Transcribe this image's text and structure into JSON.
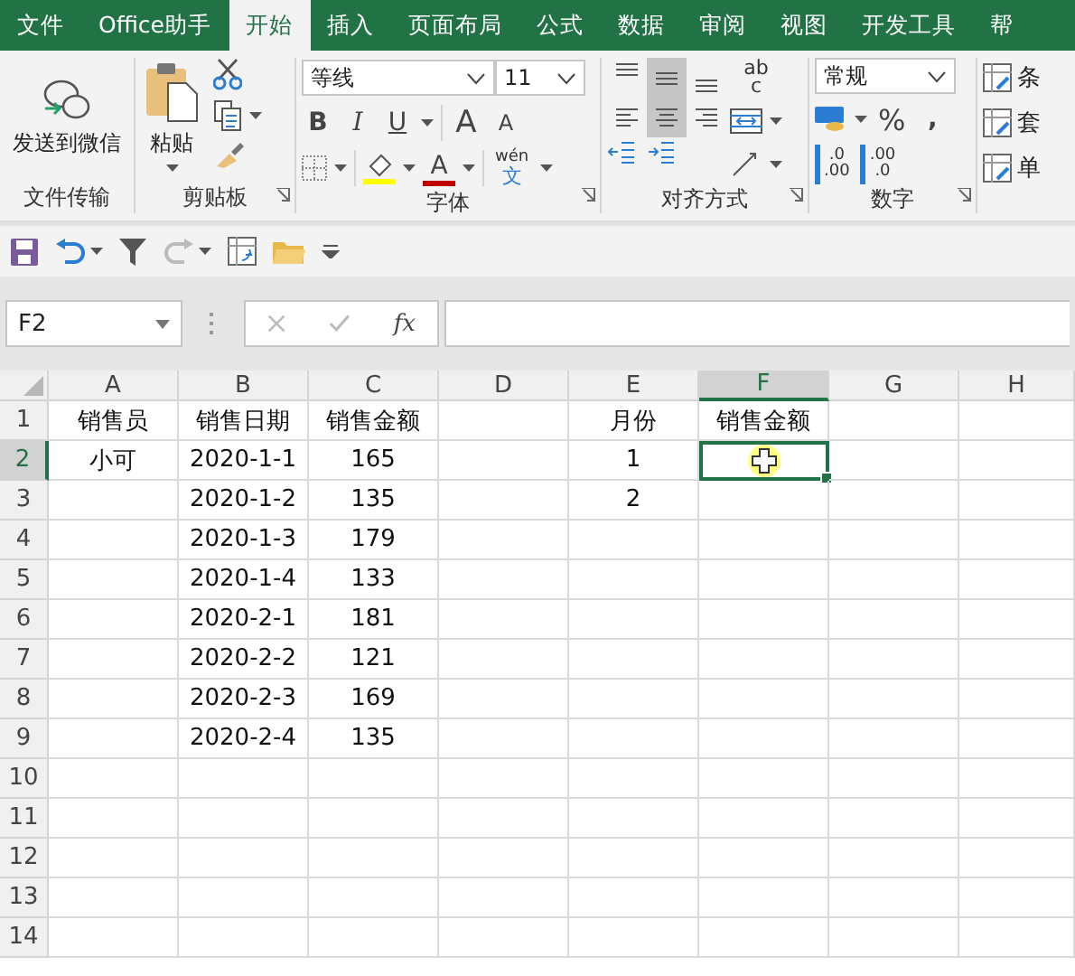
{
  "menu_tabs": [
    {
      "label": "文件",
      "selected": false
    },
    {
      "label": "Office助手",
      "selected": false
    },
    {
      "label": "开始",
      "selected": true
    },
    {
      "label": "插入",
      "selected": false
    },
    {
      "label": "页面布局",
      "selected": false
    },
    {
      "label": "公式",
      "selected": false
    },
    {
      "label": "数据",
      "selected": false
    },
    {
      "label": "审阅",
      "selected": false
    },
    {
      "label": "视图",
      "selected": false
    },
    {
      "label": "开发工具",
      "selected": false
    },
    {
      "label": "帮",
      "selected": false
    }
  ],
  "ribbon": {
    "share": {
      "button": "发送到微信",
      "label": "文件传输"
    },
    "clipboard": {
      "paste": "粘贴",
      "label": "剪贴板"
    },
    "font": {
      "font_name": "等线",
      "font_size": "11",
      "style_buttons": [
        "B",
        "I",
        "U"
      ],
      "grow": "A",
      "shrink": "A",
      "color_letter": "A",
      "phonetic_top": "wén",
      "phonetic_bottom": "文",
      "label": "字体"
    },
    "alignment": {
      "buttons": [
        {
          "kind": "top",
          "selected": false
        },
        {
          "kind": "middle",
          "selected": true
        },
        {
          "kind": "bottom",
          "selected": false
        },
        {
          "kind": "left",
          "selected": false
        },
        {
          "kind": "center",
          "selected": true
        },
        {
          "kind": "right",
          "selected": false
        }
      ],
      "wrap_top": "ab",
      "wrap_bottom": "c",
      "label": "对齐方式"
    },
    "number": {
      "format": "常规",
      "percent": "%",
      "comma": ",",
      "decimals": [
        {
          "top": ".0",
          "bottom": ".00"
        },
        {
          "top": ".00",
          "bottom": ".0"
        }
      ],
      "label": "数字"
    },
    "styles": {
      "items": [
        "条",
        "套",
        "单"
      ]
    }
  },
  "name_box": "F2",
  "fx": "fx",
  "columns": [
    {
      "label": "A",
      "selected": false
    },
    {
      "label": "B",
      "selected": false
    },
    {
      "label": "C",
      "selected": false
    },
    {
      "label": "D",
      "selected": false
    },
    {
      "label": "E",
      "selected": false
    },
    {
      "label": "F",
      "selected": true
    },
    {
      "label": "G",
      "selected": false
    },
    {
      "label": "H",
      "selected": false
    }
  ],
  "rows": [
    {
      "number": "1",
      "selected": false,
      "cells": [
        "销售员",
        "销售日期",
        "销售金额",
        null,
        "月份",
        "销售金额"
      ]
    },
    {
      "number": "2",
      "selected": true,
      "cells": [
        "小可",
        "2020-1-1",
        "165",
        null,
        "1"
      ]
    },
    {
      "number": "3",
      "selected": false,
      "cells": [
        null,
        "2020-1-2",
        "135",
        null,
        "2"
      ]
    },
    {
      "number": "4",
      "selected": false,
      "cells": [
        null,
        "2020-1-3",
        "179"
      ]
    },
    {
      "number": "5",
      "selected": false,
      "cells": [
        null,
        "2020-1-4",
        "133"
      ]
    },
    {
      "number": "6",
      "selected": false,
      "cells": [
        null,
        "2020-2-1",
        "181"
      ]
    },
    {
      "number": "7",
      "selected": false,
      "cells": [
        null,
        "2020-2-2",
        "121"
      ]
    },
    {
      "number": "8",
      "selected": false,
      "cells": [
        null,
        "2020-2-3",
        "169"
      ]
    },
    {
      "number": "9",
      "selected": false,
      "cells": [
        null,
        "2020-2-4",
        "135"
      ]
    },
    {
      "number": "10",
      "selected": false,
      "cells": []
    },
    {
      "number": "11",
      "selected": false,
      "cells": []
    },
    {
      "number": "12",
      "selected": false,
      "cells": []
    },
    {
      "number": "13",
      "selected": false,
      "cells": []
    },
    {
      "number": "14",
      "selected": false,
      "cells": []
    }
  ]
}
